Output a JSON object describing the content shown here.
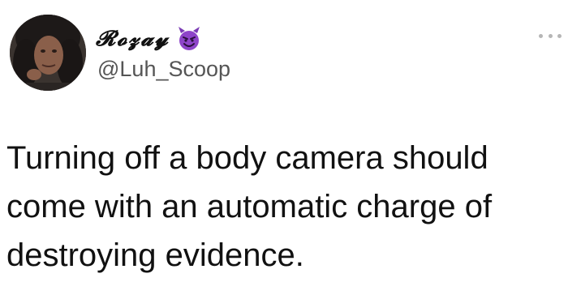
{
  "author": {
    "display_name": "𝓡𝓸𝔃𝓪𝔂",
    "handle": "@Luh_Scoop",
    "emoji": "smiling-devil-icon"
  },
  "tweet": {
    "text": "Turning off a body camera should come with an automatic charge of destroying evidence."
  },
  "colors": {
    "background": "#ffffff",
    "text": "#111111",
    "handle": "#555555",
    "emoji_purple": "#8e44c9",
    "more_dots": "#b6b6b6"
  }
}
